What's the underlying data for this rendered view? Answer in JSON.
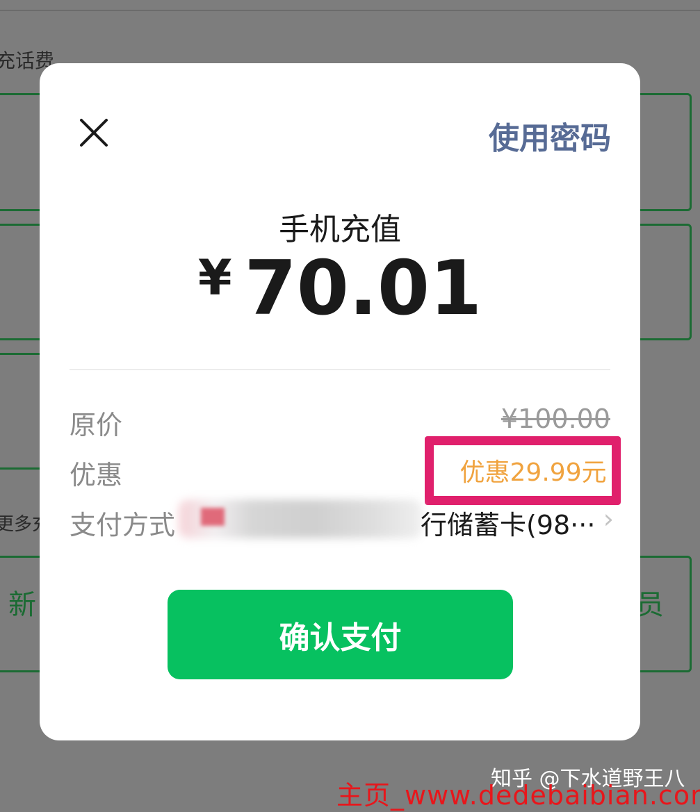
{
  "background": {
    "section_title": "充话费",
    "more_text": "更多充",
    "card_left_text": "新",
    "card_right_text": "员"
  },
  "dialog": {
    "close_icon": "close-icon",
    "use_password_label": "使用密码",
    "title": "手机充值",
    "currency_symbol": "¥",
    "amount": "70.01",
    "rows": {
      "original_price_label": "原价",
      "original_price_value": "¥100.00",
      "discount_label": "优惠",
      "discount_value": "优惠29.99元",
      "payment_method_label": "支付方式",
      "payment_method_value": "行储蓄卡(98···"
    },
    "confirm_button_label": "确认支付"
  },
  "watermarks": {
    "zhihu": "知乎 @下水道野王八",
    "site": "主页_www.dedebaibian.com"
  },
  "colors": {
    "accent_green": "#07c160",
    "link_blue": "#576b95",
    "discount_orange": "#f0a33f",
    "highlight_pink": "#e0206c"
  }
}
